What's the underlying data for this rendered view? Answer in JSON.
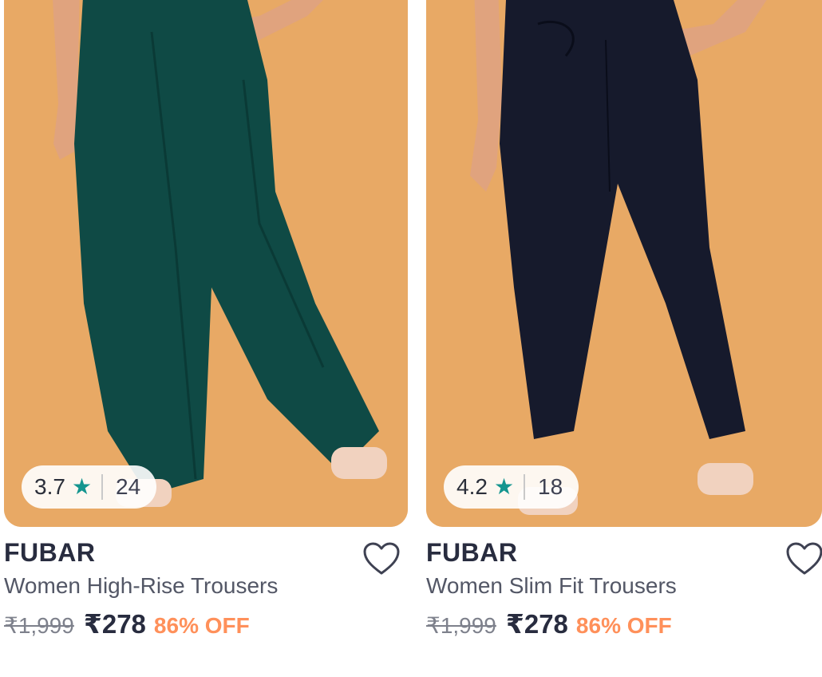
{
  "products": [
    {
      "rating": {
        "score": "3.7",
        "star": "★",
        "count": "24"
      },
      "brand": "FUBAR",
      "title": "Women High-Rise Trousers",
      "mrp": "₹1,999",
      "price": "₹278",
      "discount": "86% OFF",
      "image": {
        "background": "#e8a965",
        "trouser_color": "#0f4a45"
      }
    },
    {
      "rating": {
        "score": "4.2",
        "star": "★",
        "count": "18"
      },
      "brand": "FUBAR",
      "title": "Women Slim Fit Trousers",
      "mrp": "₹1,999",
      "price": "₹278",
      "discount": "86% OFF",
      "image": {
        "background": "#e8a965",
        "trouser_color": "#161a2c"
      }
    }
  ],
  "colors": {
    "rating_star": "#14958f",
    "discount": "#ff905a",
    "brand_text": "#282c3f"
  }
}
